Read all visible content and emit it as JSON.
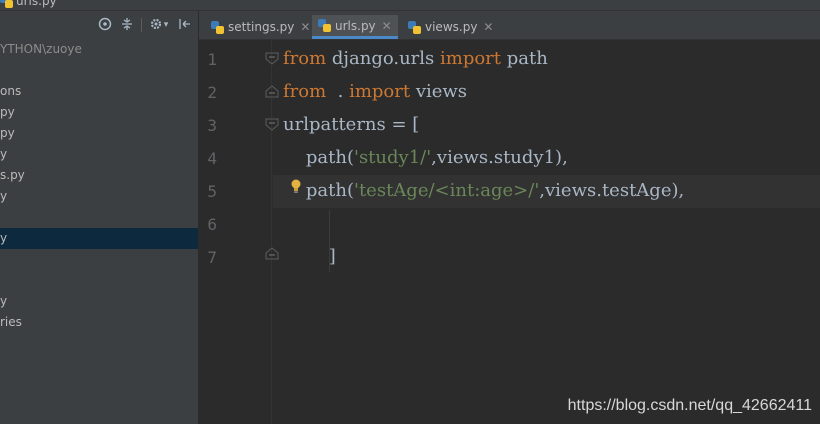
{
  "window": {
    "title_tab": "urls.py"
  },
  "sidebar": {
    "project_path": "YTHON\\zuoye",
    "items": [
      {
        "label": "ons"
      },
      {
        "label": "py"
      },
      {
        "label": "py"
      },
      {
        "label": "y"
      },
      {
        "label": "s.py"
      },
      {
        "label": "y"
      },
      {
        "label": "y",
        "selected": true
      },
      {
        "label": "y"
      },
      {
        "label": "ries"
      }
    ]
  },
  "tabs": [
    {
      "label": "settings.py",
      "active": false
    },
    {
      "label": "urls.py",
      "active": true
    },
    {
      "label": "views.py",
      "active": false
    }
  ],
  "editor": {
    "line_numbers": [
      "1",
      "2",
      "3",
      "4",
      "5",
      "6",
      "7"
    ],
    "lines": [
      {
        "kw1": "from",
        "t1": " django.urls ",
        "kw2": "import",
        "t2": " path"
      },
      {
        "kw1": "from",
        "t1": "  . ",
        "kw2": "import",
        "t2": " views"
      },
      {
        "t1": "urlpatterns = ["
      },
      {
        "t1": "    path(",
        "s1": "'study1/'",
        "t2": ",views.study1),"
      },
      {
        "t1": "    path(",
        "s1": "'testAge/<int:age>/'",
        "t2": ",views.testAge),"
      },
      {
        "t1": ""
      },
      {
        "t1": "        ]"
      }
    ],
    "highlighted_line": 5
  },
  "watermark": "https://blog.csdn.net/qq_42662411",
  "colors": {
    "keyword": "#cc7832",
    "string": "#6a8759",
    "text": "#a9b7c6",
    "selection": "#0d293e",
    "tab_underline": "#4a88c7"
  }
}
